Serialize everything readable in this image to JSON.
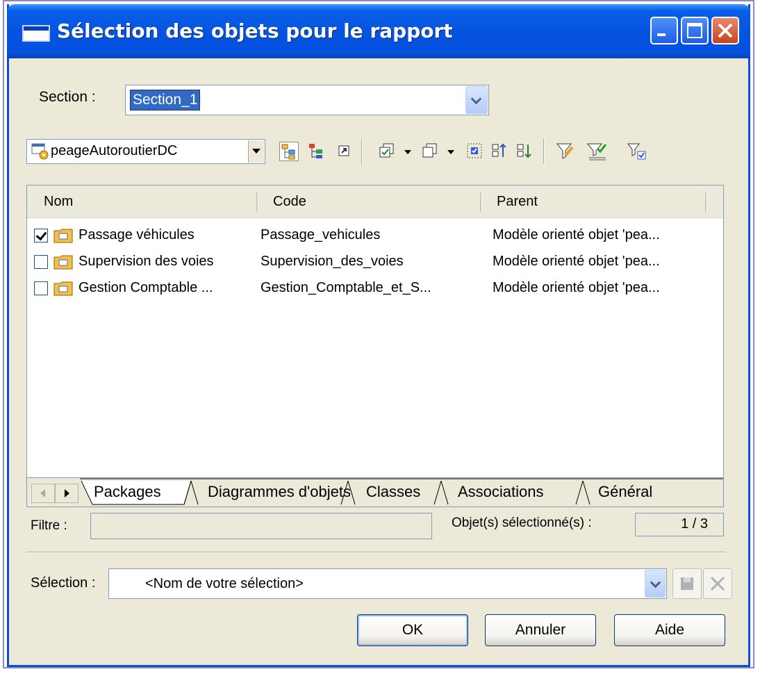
{
  "window": {
    "title": "Sélection des objets pour le rapport"
  },
  "section": {
    "label": "Section :",
    "value": "Section_1"
  },
  "model": {
    "value": "peageAutoroutierDC"
  },
  "toolbar": {
    "icons": [
      "tree-view-icon",
      "parent-tree-icon",
      "shortcut-icon",
      "select-all-icon",
      "deselect-all-icon",
      "use-graphical-selection-icon",
      "move-up-icon",
      "move-down-icon",
      "define-filter-icon",
      "apply-filter-icon",
      "filter-selected-icon"
    ]
  },
  "list": {
    "columns": [
      "Nom",
      "Code",
      "Parent"
    ],
    "rows": [
      {
        "checked": true,
        "name": "Passage véhicules",
        "code": "Passage_vehicules",
        "parent": "Modèle orienté objet 'pea..."
      },
      {
        "checked": false,
        "name": "Supervision des voies",
        "code": "Supervision_des_voies",
        "parent": "Modèle orienté objet 'pea..."
      },
      {
        "checked": false,
        "name": "Gestion Comptable ...",
        "code": "Gestion_Comptable_et_S...",
        "parent": "Modèle orienté objet 'pea..."
      }
    ]
  },
  "tabs": [
    "Packages",
    "Diagrammes d'objets",
    "Classes",
    "Associations",
    "Général"
  ],
  "filter": {
    "label": "Filtre :",
    "value": ""
  },
  "selected_count": {
    "label": "Objet(s) sélectionné(s) :",
    "value": "1 / 3"
  },
  "selection": {
    "label": "Sélection :",
    "value": "<Nom de votre sélection>"
  },
  "buttons": {
    "ok": "OK",
    "cancel": "Annuler",
    "help": "Aide"
  }
}
